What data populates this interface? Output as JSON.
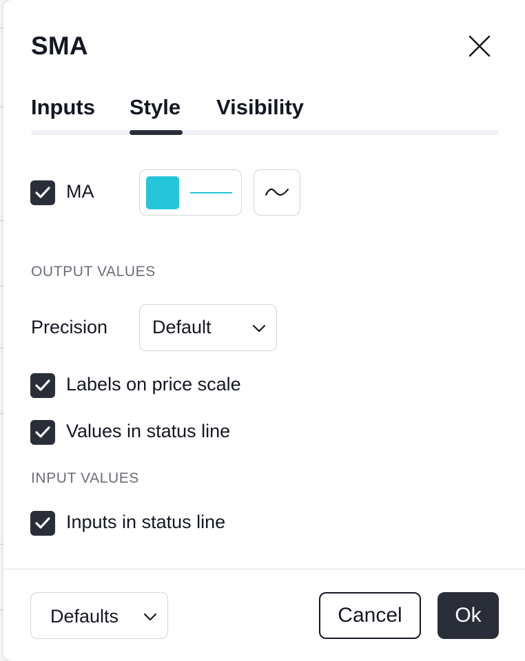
{
  "dialog": {
    "title": "SMA"
  },
  "tabs": [
    {
      "label": "Inputs"
    },
    {
      "label": "Style",
      "active": true
    },
    {
      "label": "Visibility"
    }
  ],
  "style": {
    "ma": {
      "label": "MA",
      "checked": true,
      "color": "#26c6da"
    },
    "output_values": {
      "section_title": "OUTPUT VALUES",
      "precision": {
        "label": "Precision",
        "value": "Default"
      },
      "labels_on_price_scale": {
        "label": "Labels on price scale",
        "checked": true
      },
      "values_in_status_line": {
        "label": "Values in status line",
        "checked": true
      }
    },
    "input_values": {
      "section_title": "INPUT VALUES",
      "inputs_in_status_line": {
        "label": "Inputs in status line",
        "checked": true
      }
    }
  },
  "footer": {
    "defaults_label": "Defaults",
    "cancel_label": "Cancel",
    "ok_label": "Ok"
  },
  "colors": {
    "accent_dark": "#2a2e39",
    "line_color": "#26c6da",
    "border": "#d1d4dc"
  }
}
